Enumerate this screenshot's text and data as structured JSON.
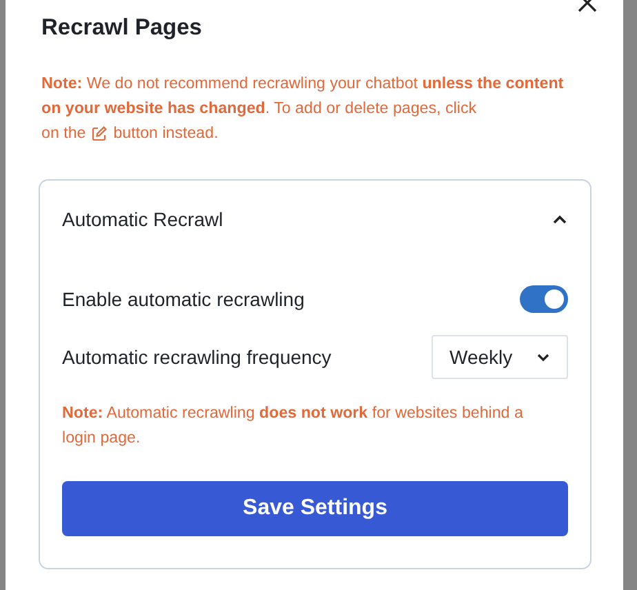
{
  "modal": {
    "title": "Recrawl Pages",
    "note": {
      "text": "**Note:** We do not recommend recrawling your chatbot **unless the content on your website has changed**. To add or delete pages, click",
      "before_icon": "on the",
      "after_icon": "button instead."
    },
    "section": {
      "title": "Automatic Recrawl",
      "expanded": true,
      "settings": [
        {
          "kind": "toggle",
          "label": "Enable automatic recrawling",
          "on": true
        },
        {
          "kind": "select",
          "label": "Automatic recrawling frequency",
          "value": "Weekly"
        }
      ],
      "note": "**Note:** Automatic recrawling **does not work** for websites behind a login page.",
      "button": "Save Settings"
    }
  }
}
